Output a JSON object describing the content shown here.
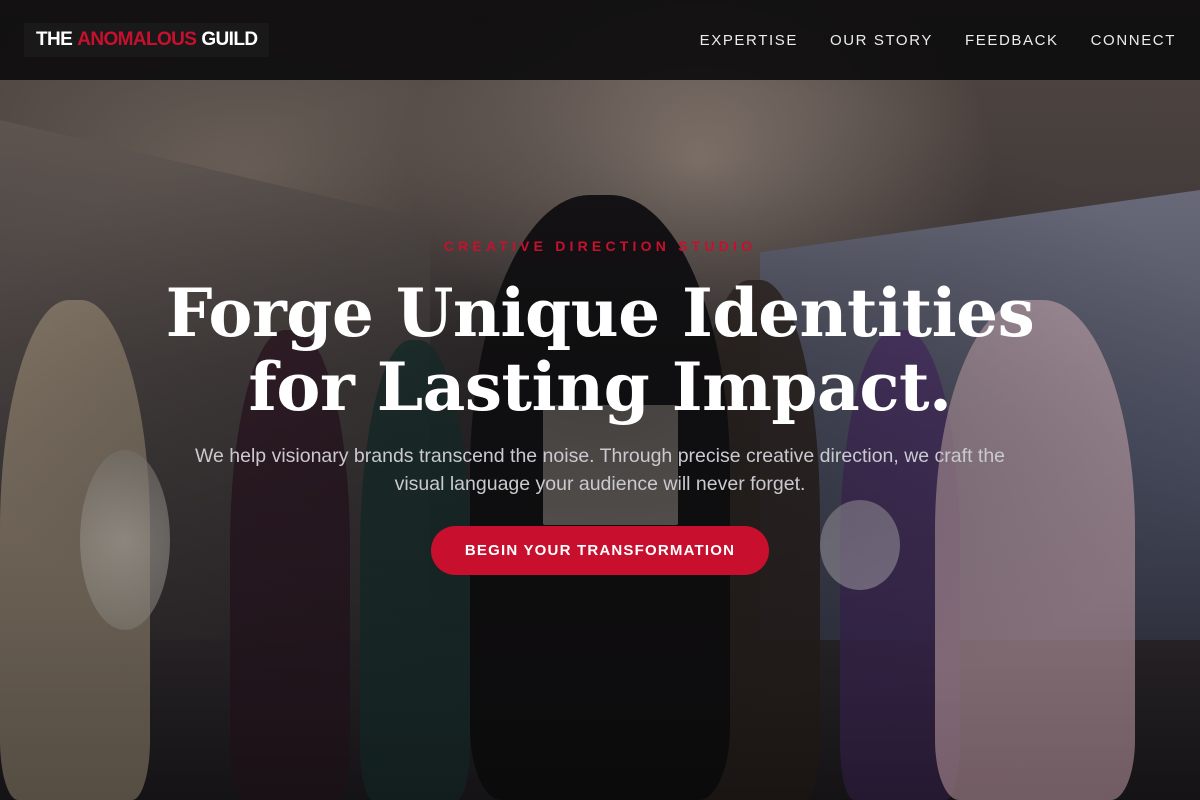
{
  "brand": {
    "logo_prefix": "THE",
    "logo_accent": "ANOMALOUS",
    "logo_suffix": "GUILD",
    "accent_color": "#c8102e"
  },
  "nav": {
    "items": [
      {
        "label": "EXPERTISE"
      },
      {
        "label": "OUR STORY"
      },
      {
        "label": "FEEDBACK"
      },
      {
        "label": "CONNECT"
      }
    ]
  },
  "hero": {
    "eyebrow": "CREATIVE DIRECTION STUDIO",
    "headline_line1": "Forge Unique Identities",
    "headline_line2": "for Lasting Impact.",
    "subtext": "We help visionary brands transcend the noise. Through precise creative direction, we craft the visual language your audience will never forget.",
    "cta_label": "BEGIN YOUR TRANSFORMATION",
    "background": "hero-photo-group-of-fashion-models"
  }
}
